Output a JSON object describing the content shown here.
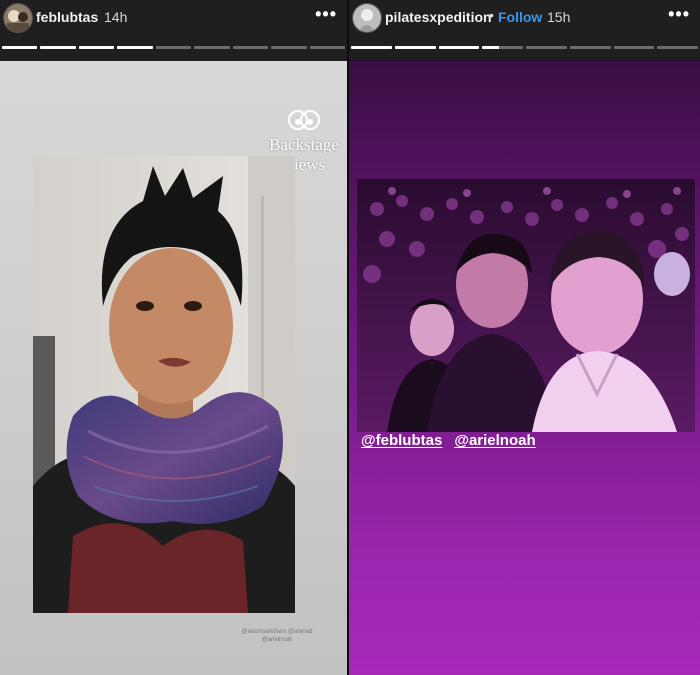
{
  "left_story": {
    "username": "feblubtas",
    "time": "14h",
    "more_icon": "more-horizontal-icon",
    "progress_fills": [
      1,
      1,
      1,
      1,
      0,
      0,
      0,
      0,
      0
    ],
    "watermark": {
      "line1": "Backstage",
      "line2": "Views"
    },
    "photo_tag_line1": "@ariclnoahxfans @atenad",
    "photo_tag_line2": "@arielnoah"
  },
  "right_story": {
    "username": "pilatesxpedition",
    "separator": "•",
    "follow_label": "Follow",
    "time": "15h",
    "more_icon": "more-horizontal-icon",
    "progress_fills": [
      1,
      1,
      1,
      0.4,
      0,
      0,
      0,
      0
    ],
    "mentions": [
      "@feblubtas",
      "@arielnoah"
    ]
  },
  "colors": {
    "follow_blue": "#3897f0",
    "right_bg_top": "#3a0d44",
    "right_bg_bottom": "#a629b8"
  }
}
